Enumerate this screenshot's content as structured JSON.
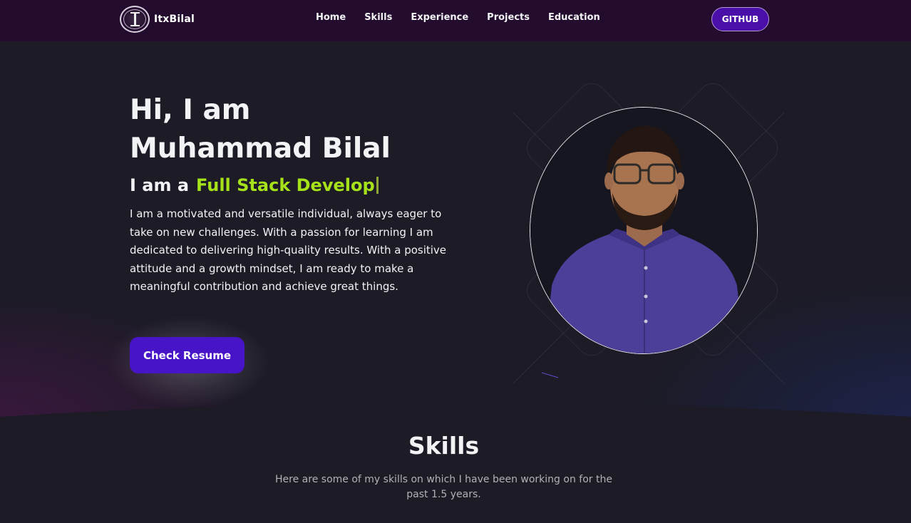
{
  "navbar": {
    "brand": "ItxBilal",
    "links": [
      "Home",
      "Skills",
      "Experience",
      "Projects",
      "Education"
    ],
    "github_label": "GITHUB"
  },
  "hero": {
    "greeting": "Hi, I am",
    "name": "Muhammad Bilal",
    "role_prefix": "I am a",
    "role_typed": "Full Stack Develop",
    "description": "I am a motivated and versatile individual, always eager to take on new challenges. With a passion for learning I am dedicated to delivering high-quality results. With a positive attitude and a growth mindset, I am ready to make a meaningful contribution and achieve great things.",
    "resume_label": "Check Resume"
  },
  "skills": {
    "title": "Skills",
    "description": "Here are some of my skills on which I have been working on for the past 1.5 years."
  },
  "colors": {
    "nav_bg": "#240c2e",
    "page_bg": "#1c1b26",
    "accent_green": "#a6e21a",
    "button_purple": "#4714c8"
  },
  "icons": {
    "logo": "ItxBilal-logo-emblem"
  }
}
